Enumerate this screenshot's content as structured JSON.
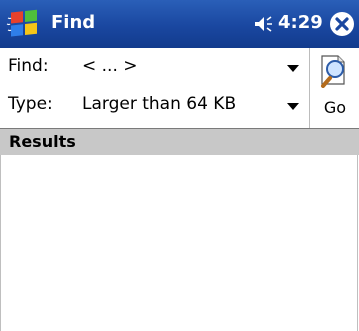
{
  "titlebar": {
    "title": "Find",
    "clock": "4:29",
    "start_icon": "windows-flag-icon",
    "volume_icon": "speaker-icon",
    "close_icon": "close-icon"
  },
  "form": {
    "find_label": "Find:",
    "find_value": "< ... >",
    "type_label": "Type:",
    "type_value": "Larger than 64 KB"
  },
  "go": {
    "label": "Go",
    "icon": "magnifier-document-icon"
  },
  "results": {
    "header": "Results",
    "items": []
  },
  "colors": {
    "titlebar": "#1a47a0",
    "results_header": "#c8c8c8"
  }
}
